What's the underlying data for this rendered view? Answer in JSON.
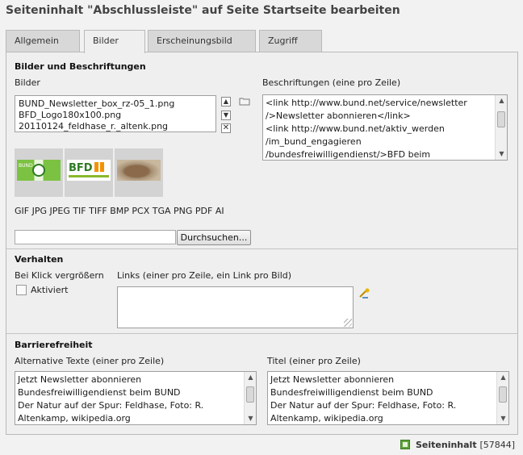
{
  "page": {
    "title": "Seiteninhalt \"Abschlussleiste\" auf Seite Startseite bearbeiten"
  },
  "tabs": [
    {
      "label": "Allgemein",
      "active": false
    },
    {
      "label": "Bilder",
      "active": true
    },
    {
      "label": "Erscheinungsbild",
      "active": false
    },
    {
      "label": "Zugriff",
      "active": false
    }
  ],
  "images_section": {
    "title": "Bilder und Beschriftungen",
    "images_label": "Bilder",
    "files": [
      "BUND_Newsletter_box_rz-05_1.png",
      "BFD_Logo180x100.png",
      "20110124_feldhase_r._altenk.png"
    ],
    "captions_label": "Beschriftungen (eine pro Zeile)",
    "captions_lines": [
      "<link http://www.bund.net/service/newsletter",
      "/>Newsletter abonnieren</link>",
      "<link http://www.bund.net/aktiv_werden",
      "/im_bund_engagieren",
      "/bundesfreiwilligendienst/>BFD beim"
    ],
    "thumbnails": [
      {
        "label": "BUND"
      },
      {
        "label": "BFD"
      },
      {
        "label": ""
      }
    ],
    "allowed_types": "GIF JPG JPEG TIF TIFF BMP PCX TGA PNG PDF AI",
    "browse_label": "Durchsuchen..."
  },
  "behaviour_section": {
    "title": "Verhalten",
    "click_enlarge_label": "Bei Klick vergrößern",
    "activated_label": "Aktiviert",
    "activated_checked": false,
    "links_label": "Links (einer pro Zeile, ein Link pro Bild)",
    "links_value": ""
  },
  "accessibility_section": {
    "title": "Barrierefreiheit",
    "alt_label": "Alternative Texte (einer pro Zeile)",
    "alt_lines": [
      "Jetzt Newsletter abonnieren",
      "Bundesfreiwilligendienst beim BUND",
      "Der Natur auf der Spur: Feldhase, Foto: R.",
      "Altenkamp, wikipedia.org"
    ],
    "title_label": "Titel (einer pro Zeile)",
    "title_lines": [
      "Jetzt Newsletter abonnieren",
      "Bundesfreiwilligendienst beim BUND",
      "Der Natur auf der Spur: Feldhase, Foto: R.",
      "Altenkamp, wikipedia.org"
    ]
  },
  "footer": {
    "record_type": "Seiteninhalt",
    "record_id": "[57844]"
  },
  "icons": {
    "move_up": "arrow-up-icon",
    "move_down": "arrow-down-icon",
    "remove": "close-icon",
    "browse_folder": "folder-icon",
    "link_wizard": "link-wizard-icon",
    "record": "content-element-icon"
  }
}
